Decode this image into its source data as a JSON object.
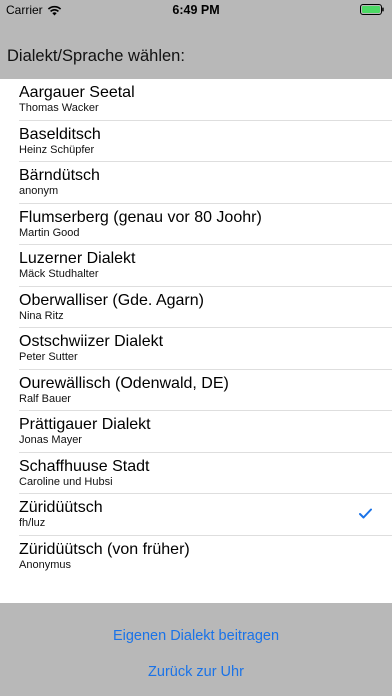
{
  "status_bar": {
    "carrier": "Carrier",
    "time": "6:49 PM",
    "wifi_icon": "wifi-icon",
    "battery_icon": "battery-icon",
    "battery_color": "#4cd964"
  },
  "header": {
    "title": "Dialekt/Sprache wählen:"
  },
  "dialects": [
    {
      "name": "Aargauer Seetal",
      "author": "Thomas Wacker",
      "selected": false
    },
    {
      "name": "Baselditsch",
      "author": "Heinz Schüpfer",
      "selected": false
    },
    {
      "name": "Bärndütsch",
      "author": "anonym",
      "selected": false
    },
    {
      "name": "Flumserberg (genau vor 80 Joohr)",
      "author": "Martin Good",
      "selected": false
    },
    {
      "name": "Luzerner Dialekt",
      "author": "Mäck Studhalter",
      "selected": false
    },
    {
      "name": "Oberwalliser (Gde. Agarn)",
      "author": "Nina Ritz",
      "selected": false
    },
    {
      "name": "Ostschwiizer Dialekt",
      "author": "Peter Sutter",
      "selected": false
    },
    {
      "name": "Ourewällisch (Odenwald, DE)",
      "author": "Ralf Bauer",
      "selected": false
    },
    {
      "name": "Prättigauer Dialekt",
      "author": "Jonas Mayer",
      "selected": false
    },
    {
      "name": "Schaffhuuse Stadt",
      "author": "Caroline und Hubsi",
      "selected": false
    },
    {
      "name": "Züridüütsch",
      "author": "fh/luz",
      "selected": true
    },
    {
      "name": "Züridüütsch (von früher)",
      "author": "Anonymus",
      "selected": false
    }
  ],
  "footer": {
    "contribute_label": "Eigenen Dialekt beitragen",
    "back_label": "Zurück zur Uhr"
  },
  "colors": {
    "accent": "#1a73e8",
    "background": "#b8b8b8"
  }
}
